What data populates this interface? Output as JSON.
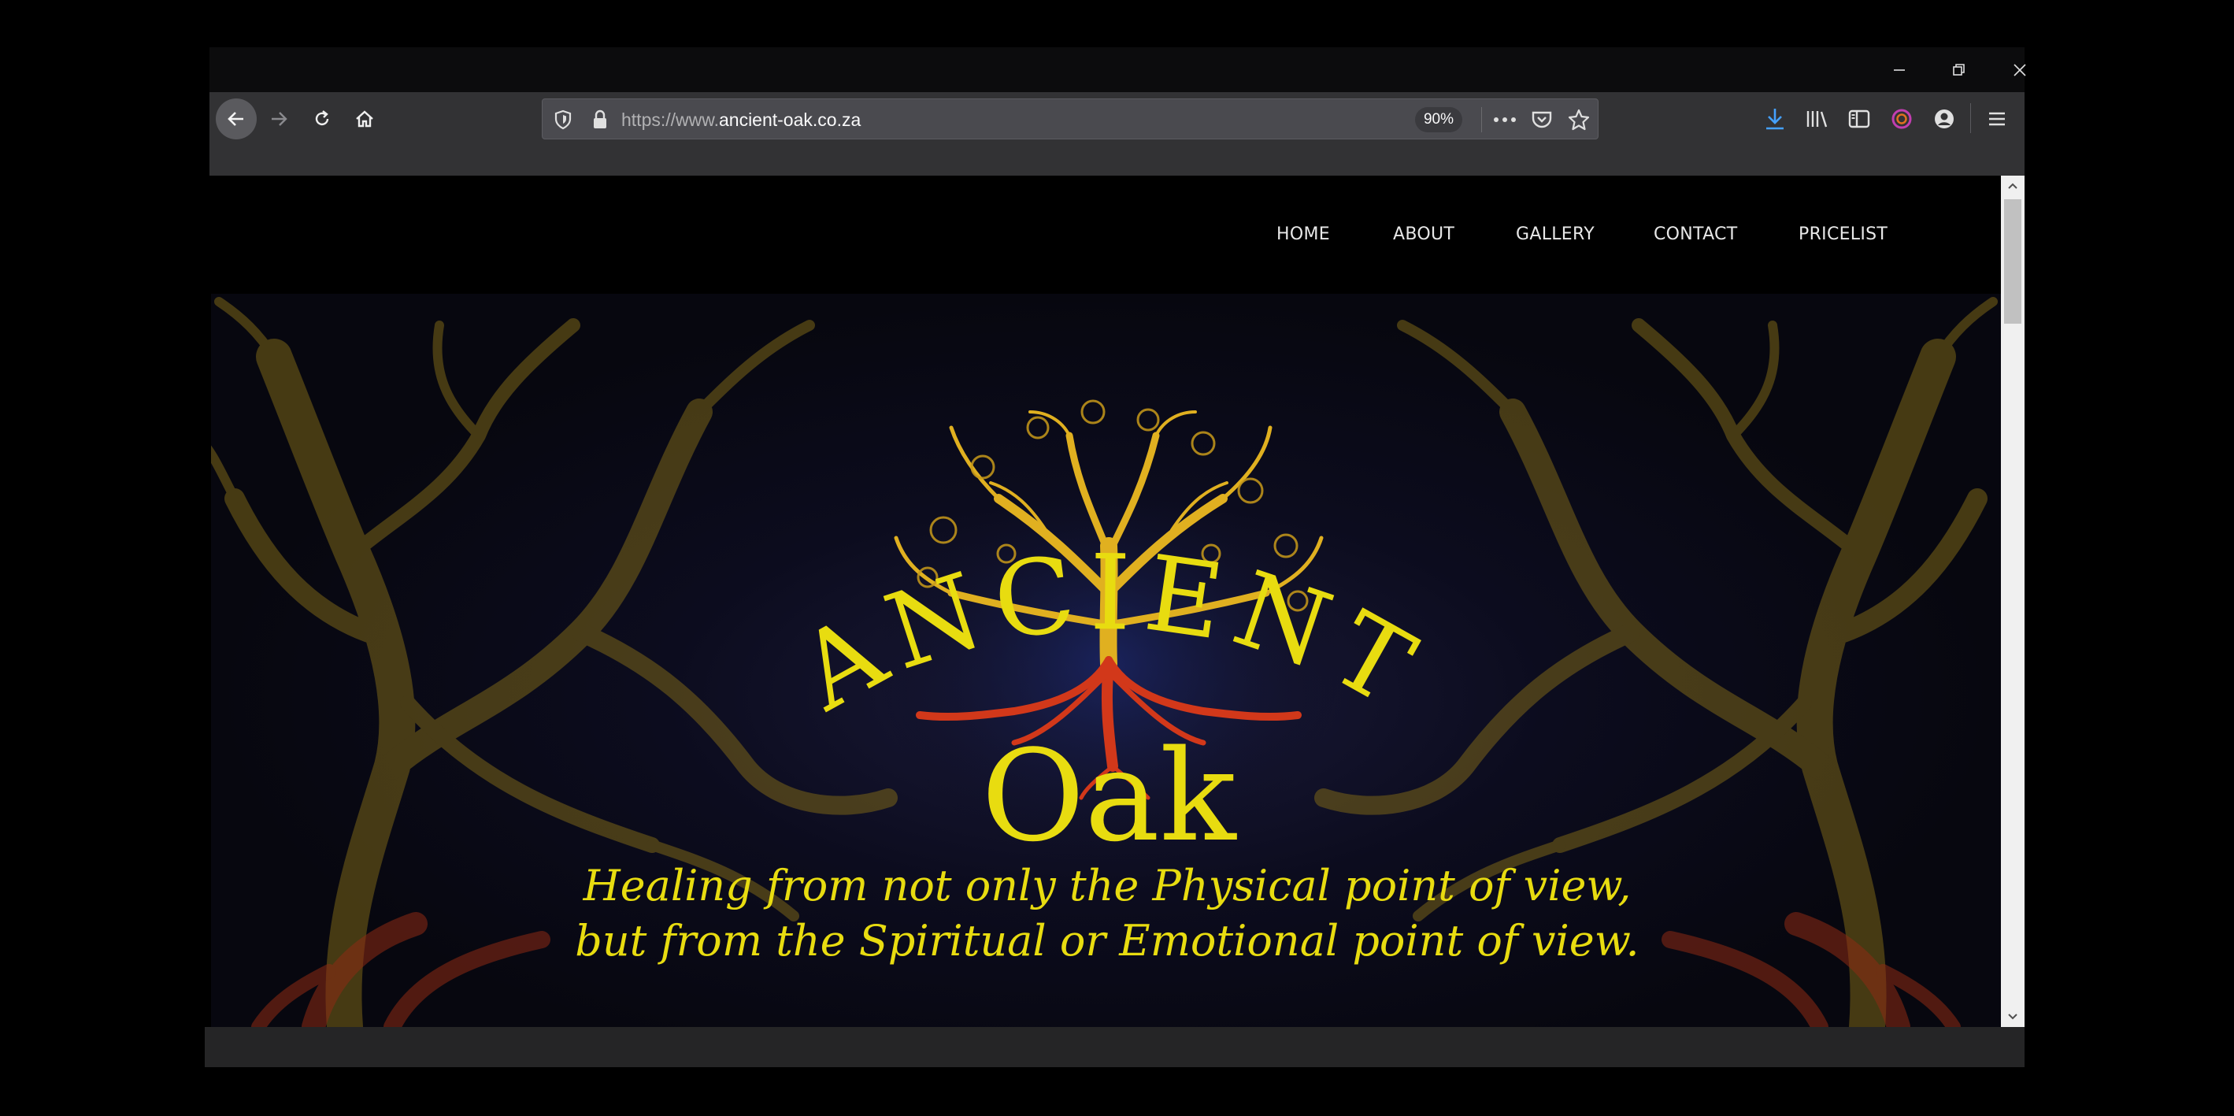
{
  "browser": {
    "url_prefix": "https://www.",
    "url_domain": "ancient-oak.co.za",
    "zoom": "90%",
    "accent_download": "#45a1ff"
  },
  "nav": {
    "items": [
      "HOME",
      "ABOUT",
      "GALLERY",
      "CONTACT",
      "PRICELIST"
    ]
  },
  "hero": {
    "logo_word1": "ANCIENT",
    "logo_word2": "Oak",
    "tagline_line1": "Healing from not only the Physical point of view,",
    "tagline_line2": "but from the Spiritual or Emotional point of view.",
    "text_color": "#e8dc10",
    "root_color": "#d2381a"
  }
}
